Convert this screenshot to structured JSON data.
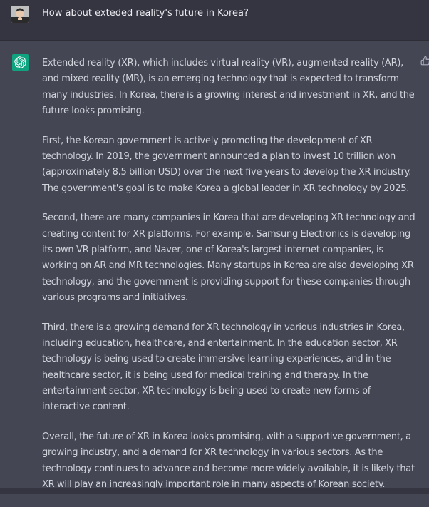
{
  "user_message": {
    "text": "How about exteded reality's future in Korea?"
  },
  "assistant_message": {
    "paragraphs": [
      "Extended reality (XR), which includes virtual reality (VR), augmented reality (AR), and mixed reality (MR), is an emerging technology that is expected to transform many industries. In Korea, there is a growing interest and investment in XR, and the future looks promising.",
      "First, the Korean government is actively promoting the development of XR technology. In 2019, the government announced a plan to invest 10 trillion won (approximately 8.5 billion USD) over the next five years to develop the XR industry. The government's goal is to make Korea a global leader in XR technology by 2025.",
      "Second, there are many companies in Korea that are developing XR technology and creating content for XR platforms. For example, Samsung Electronics is developing its own VR platform, and Naver, one of Korea's largest internet companies, is working on AR and MR technologies. Many startups in Korea are also developing XR technology, and the government is providing support for these companies through various programs and initiatives.",
      "Third, there is a growing demand for XR technology in various industries in Korea, including education, healthcare, and entertainment. In the education sector, XR technology is being used to create immersive learning experiences, and in the healthcare sector, it is being used for medical training and therapy. In the entertainment sector, XR technology is being used to create new forms of interactive content.",
      "Overall, the future of XR in Korea looks promising, with a supportive government, a growing industry, and a demand for XR technology in various sectors. As the technology continues to advance and become more widely available, it is likely that XR will play an increasingly important role in many aspects of Korean society."
    ]
  },
  "icons": {
    "user": "user-avatar",
    "assistant": "chatgpt-logo-icon",
    "feedback": "thumbs-up-icon"
  },
  "colors": {
    "user_bg": "#343541",
    "assistant_bg": "#444654",
    "brand": "#10a37f",
    "text": "#d1d5db"
  }
}
